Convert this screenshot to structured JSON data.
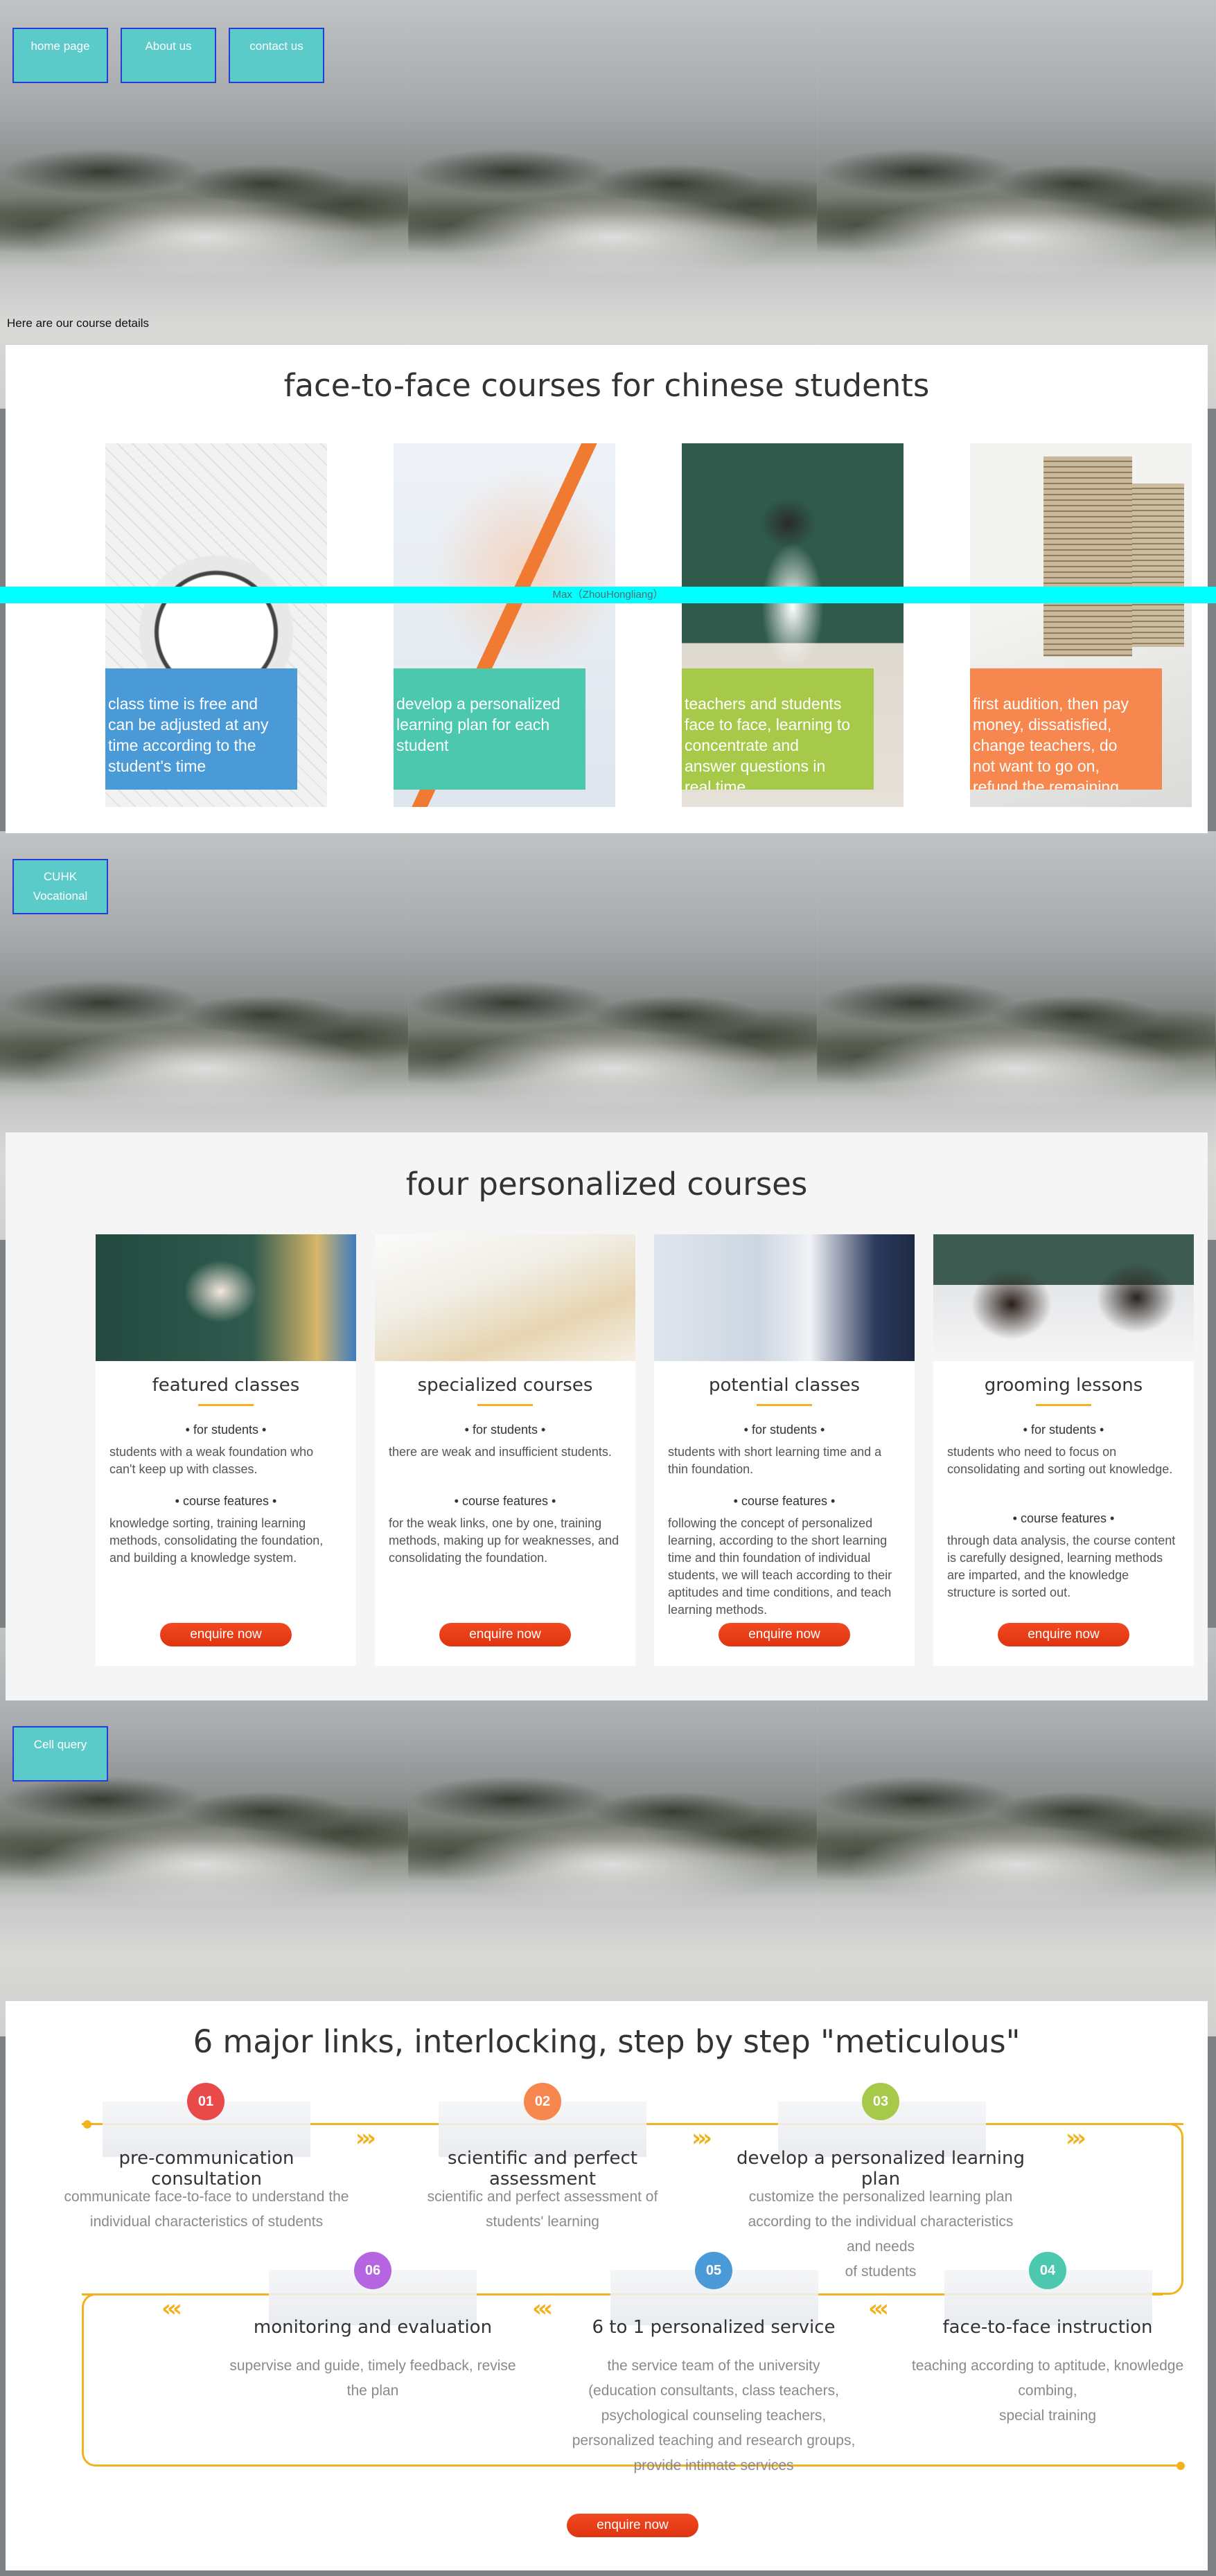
{
  "nav": {
    "home": "home page",
    "about": "About us",
    "contact": "contact us"
  },
  "intro": "Here are our course details",
  "section1": {
    "title": "face-to-face courses for chinese students",
    "cards": [
      {
        "label": "class time is free and can be adjusted at any time according to the student's time",
        "color": "#4a9ad8",
        "image": "alarm-clock"
      },
      {
        "label": "develop a personalized learning plan for each student",
        "color": "#4cc8ae",
        "image": "pencil-writing"
      },
      {
        "label": "teachers and students face to face, learning to concentrate and answer questions in real time",
        "color": "#a7c94a",
        "image": "classroom-teacher"
      },
      {
        "label": "first audition, then pay money, dissatisfied, change teachers, do not want to go on, refund the remaining",
        "color": "#f5874f",
        "image": "coins-calculator"
      }
    ]
  },
  "author": "Max（ZhouHongliang）",
  "cuhk": {
    "line1": "CUHK",
    "line2": "Vocational"
  },
  "section2": {
    "title": "four personalized courses",
    "for_students": "• for students •",
    "course_features": "• course features •",
    "enquire": "enquire now",
    "courses": [
      {
        "title": "featured classes",
        "students": "students with a weak foundation who can't keep up with classes.",
        "features": "knowledge sorting, training learning methods, consolidating the foundation, and building a knowledge system."
      },
      {
        "title": "specialized courses",
        "students": "there are weak and insufficient students.",
        "features": "for the weak links, one by one, training methods, making up for weaknesses, and consolidating the foundation."
      },
      {
        "title": "potential classes",
        "students": "students with short learning time and a thin foundation.",
        "features": "following the concept of personalized learning, according to the short learning time and thin foundation of individual students, we will teach according to their aptitudes and time conditions, and teach learning methods."
      },
      {
        "title": "grooming lessons",
        "students": "students who need to focus on consolidating and sorting out knowledge.",
        "features": "through data analysis, the course content is carefully designed, learning methods are imparted, and the knowledge structure is sorted out."
      }
    ]
  },
  "cell_query": "Cell query",
  "section3": {
    "title": "6 major links, interlocking, step by step \"meticulous\"",
    "enquire": "enquire now",
    "steps": [
      {
        "num": "01",
        "color": "#e84a4a",
        "title": "pre-communication consultation",
        "desc": [
          "communicate face-to-face to understand the",
          "individual characteristics of students"
        ]
      },
      {
        "num": "02",
        "color": "#f5874f",
        "title": "scientific and perfect assessment",
        "desc": [
          "scientific and perfect assessment of",
          "students' learning"
        ]
      },
      {
        "num": "03",
        "color": "#a7c94a",
        "title": "develop a personalized learning plan",
        "desc": [
          "customize the personalized learning plan",
          "according to the individual characteristics",
          "and needs",
          "of students"
        ]
      },
      {
        "num": "04",
        "color": "#4cc8ae",
        "title": "face-to-face instruction",
        "desc": [
          "teaching according to aptitude, knowledge combing,",
          "special training"
        ]
      },
      {
        "num": "05",
        "color": "#4a9ad8",
        "title": "6 to 1 personalized service",
        "desc": [
          "the service team of the university",
          "(education consultants, class teachers,",
          "psychological counseling teachers,",
          "personalized teaching and research groups,",
          "provide intimate services"
        ]
      },
      {
        "num": "06",
        "color": "#b565e0",
        "title": "monitoring and evaluation",
        "desc": [
          "supervise and guide, timely feedback, revise",
          "the plan"
        ]
      }
    ]
  }
}
